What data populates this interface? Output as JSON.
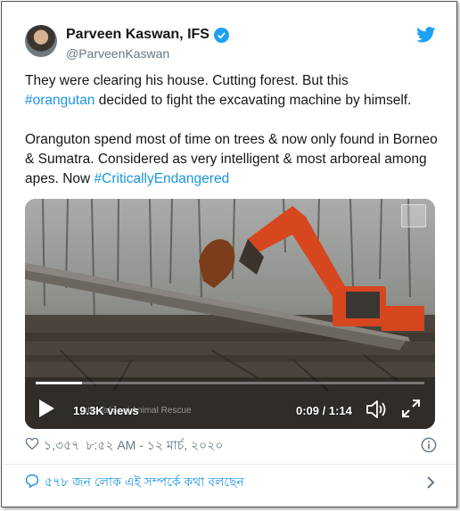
{
  "user": {
    "display_name": "Parveen Kaswan, IFS",
    "handle": "@ParveenKaswan"
  },
  "tweet": {
    "line1_a": "They were clearing his house. Cutting forest. But this",
    "hashtag1": "#orangutan",
    "line2_rest": " decided to fight the excavating machine by himself.",
    "para2_text": "Oranguton spend most of time on trees & now only found in Borneo & Sumatra. Considered as very intelligent & most arboreal among apes. Now ",
    "hashtag2": "#CriticallyEndangered"
  },
  "video": {
    "views": "19.3K views",
    "watermark": "International Animal Rescue",
    "time": "0:09 / 1:14",
    "progress": 0.12
  },
  "meta": {
    "likes": "১,৩৫৭",
    "timestamp": "৮:৫২ AM - ১২ মার্চ, ২০২০"
  },
  "conversation": {
    "label": "৫৭৮ জন লোক এই সম্পর্কে কথা বলছেন"
  },
  "colors": {
    "link": "#1b95e0",
    "verified": "#1da1f2",
    "secondary": "#657786"
  },
  "icons": [
    "verified-badge-icon",
    "twitter-bird-icon",
    "play-icon",
    "volume-icon",
    "fullscreen-icon",
    "heart-icon",
    "info-icon",
    "chat-bubble-icon",
    "chevron-right-icon"
  ]
}
